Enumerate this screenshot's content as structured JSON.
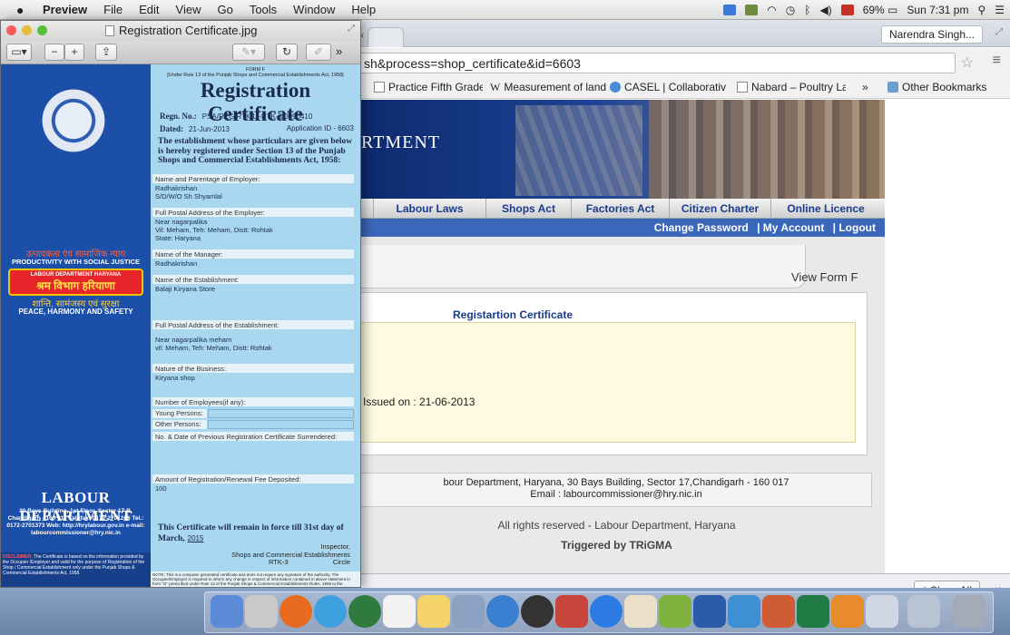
{
  "menubar": {
    "app": "Preview",
    "menus": [
      "File",
      "Edit",
      "View",
      "Go",
      "Tools",
      "Window",
      "Help"
    ],
    "battery": "69%",
    "clock": "Sun 7:31 pm"
  },
  "browser": {
    "user": "Narendra Singh...",
    "url": "sh&process=shop_certificate&id=6603",
    "bookmarks": [
      "Practice Fifth Grade",
      "Measurement of land",
      "CASEL | Collaborative",
      "Nabard – Poultry Lay"
    ],
    "bookmarks_more": "»",
    "other_bookmarks": "Other Bookmarks",
    "banner_text": "RTMENT",
    "nav": [
      "Labour Laws",
      "Shops Act",
      "Factories Act",
      "Citizen Charter",
      "Online Licence"
    ],
    "subnav": [
      "Change Password",
      "| My Account",
      "| Logout"
    ],
    "view_form": "View Form F",
    "cert_title": "Registartion Certificate",
    "issued": "Issued on : 21-06-2013",
    "footer_line1": "bour Department, Haryana, 30 Bays Building, Sector 17,Chandigarh - 160 017",
    "footer_line2": "Email : labourcommissioner@hry.nic.in",
    "rights": "All rights reserved - Labour Department, Haryana",
    "triggered": "Triggered by TRiGMA",
    "show_all": "Show All",
    "close": "×"
  },
  "preview": {
    "filename": "Registration Certificate.jpg"
  },
  "certificate": {
    "hindi1": "उत्पादकता एंव सामाजिक न्याय",
    "productivity": "PRODUCTIVITY WITH SOCIAL JUSTICE",
    "dept_small": "LABOUR DEPARTMENT HARYANA",
    "dept_hindi": "श्रम विभाग हरियाणा",
    "hindi2": "शान्ति, सामंजस्य एवं सुरक्षा",
    "peace": "PEACE, HARMONY AND SAFETY",
    "ld_title": "LABOUR DEPARTMENT",
    "ld_address": "30 Bays Building, 1st Floor, Sector 17-B, Chandigarh - 160 017 Telefax: 0172-2701266 Tel.: 0172-2701373 Web: http://hrylabour.gov.in e-mail: labourcommissioner@hry.nic.in",
    "disclaimer_label": "DISCLAIMER:",
    "disclaimer": "The Certificate is based on the information provided by the Occupier /Employer and valid for the purpose of Registration of the Shop / Commercial Establishment only under the Punjab Shops & Commercial Establishments Act, 1958.",
    "form_f": "FORM F",
    "rule": "[Under Rule 13 of the Punjab Shops and Commercial Establishments Act, 1958]",
    "title": "Registration Certificate",
    "regn_label": "Regn. No.:",
    "regn_no": "PSA/REG/RTK/LI-RTK-3/0090410",
    "dated_label": "Dated:",
    "dated": "21-Jun-2013",
    "app_id": "Application ID - 6603",
    "intro": "The establishment whose particulars are given below is hereby registered under Section 13 of the Punjab Shops and Commercial Establishments Act, 1958:",
    "fields": [
      {
        "label": "Name and Parentage of Employer:",
        "value": "Radhakrishan\nS/D/W/O Sh Shyamlal"
      },
      {
        "label": "Full Postal Address of the Employer:",
        "value": "Near nagarpalika\nVil: Meham, Teh: Meham, Distt: Rohtak\nState: Haryana"
      },
      {
        "label": "Name of the Manager:",
        "value": "Radhakrishan"
      },
      {
        "label": "Name of the Establishment:",
        "value": "Balaji Kiryana Store"
      },
      {
        "label": "Full Postal Address of the Establishment:",
        "value": "Near nagarpalika meham\nvil: Meham, Teh: Meham, Distt: Rohtak"
      },
      {
        "label": "Nature of the Business:",
        "value": "Kiryana shop"
      },
      {
        "label": "Number of Employees(if any):",
        "value": ""
      },
      {
        "label": "No. & Date of Previous Registration Certificate Surrendered:",
        "value": ""
      },
      {
        "label": "Amount of Registration/Renewal Fee Deposited:",
        "value": "100"
      }
    ],
    "young_persons": "Young Persons:",
    "other_persons": "Other Persons:",
    "remain": "This Certificate will remain in force till 31st day of March,",
    "year": "2015",
    "inspector": "Inspector,",
    "shops": "Shops and Commercial Establishments",
    "rtk": "RTK-3",
    "circle": "Circle",
    "note": "NOTE: This is a computer generated certificate and does not require any signature of the authority. The Occupier/Employer is required to inform any change in respect of information contained in above statement in form \"G\" prescribed under Rule 13 of the Punjab Shops & Commercial Establishments Rules, 1958 to the concerned authority / Labour Inspector."
  }
}
